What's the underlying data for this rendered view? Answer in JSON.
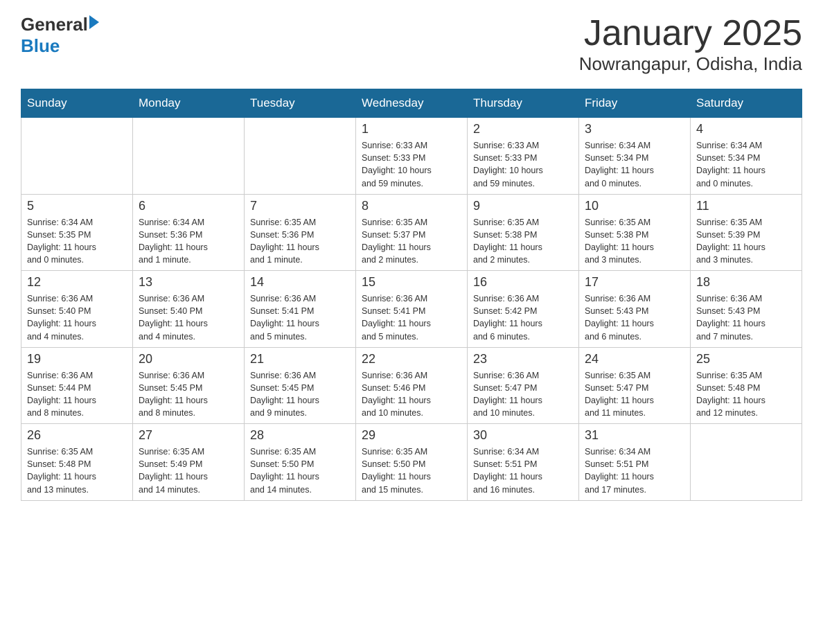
{
  "header": {
    "logo_general": "General",
    "logo_blue": "Blue",
    "month_title": "January 2025",
    "location": "Nowrangapur, Odisha, India"
  },
  "weekdays": [
    "Sunday",
    "Monday",
    "Tuesday",
    "Wednesday",
    "Thursday",
    "Friday",
    "Saturday"
  ],
  "weeks": [
    [
      {
        "day": "",
        "info": ""
      },
      {
        "day": "",
        "info": ""
      },
      {
        "day": "",
        "info": ""
      },
      {
        "day": "1",
        "info": "Sunrise: 6:33 AM\nSunset: 5:33 PM\nDaylight: 10 hours\nand 59 minutes."
      },
      {
        "day": "2",
        "info": "Sunrise: 6:33 AM\nSunset: 5:33 PM\nDaylight: 10 hours\nand 59 minutes."
      },
      {
        "day": "3",
        "info": "Sunrise: 6:34 AM\nSunset: 5:34 PM\nDaylight: 11 hours\nand 0 minutes."
      },
      {
        "day": "4",
        "info": "Sunrise: 6:34 AM\nSunset: 5:34 PM\nDaylight: 11 hours\nand 0 minutes."
      }
    ],
    [
      {
        "day": "5",
        "info": "Sunrise: 6:34 AM\nSunset: 5:35 PM\nDaylight: 11 hours\nand 0 minutes."
      },
      {
        "day": "6",
        "info": "Sunrise: 6:34 AM\nSunset: 5:36 PM\nDaylight: 11 hours\nand 1 minute."
      },
      {
        "day": "7",
        "info": "Sunrise: 6:35 AM\nSunset: 5:36 PM\nDaylight: 11 hours\nand 1 minute."
      },
      {
        "day": "8",
        "info": "Sunrise: 6:35 AM\nSunset: 5:37 PM\nDaylight: 11 hours\nand 2 minutes."
      },
      {
        "day": "9",
        "info": "Sunrise: 6:35 AM\nSunset: 5:38 PM\nDaylight: 11 hours\nand 2 minutes."
      },
      {
        "day": "10",
        "info": "Sunrise: 6:35 AM\nSunset: 5:38 PM\nDaylight: 11 hours\nand 3 minutes."
      },
      {
        "day": "11",
        "info": "Sunrise: 6:35 AM\nSunset: 5:39 PM\nDaylight: 11 hours\nand 3 minutes."
      }
    ],
    [
      {
        "day": "12",
        "info": "Sunrise: 6:36 AM\nSunset: 5:40 PM\nDaylight: 11 hours\nand 4 minutes."
      },
      {
        "day": "13",
        "info": "Sunrise: 6:36 AM\nSunset: 5:40 PM\nDaylight: 11 hours\nand 4 minutes."
      },
      {
        "day": "14",
        "info": "Sunrise: 6:36 AM\nSunset: 5:41 PM\nDaylight: 11 hours\nand 5 minutes."
      },
      {
        "day": "15",
        "info": "Sunrise: 6:36 AM\nSunset: 5:41 PM\nDaylight: 11 hours\nand 5 minutes."
      },
      {
        "day": "16",
        "info": "Sunrise: 6:36 AM\nSunset: 5:42 PM\nDaylight: 11 hours\nand 6 minutes."
      },
      {
        "day": "17",
        "info": "Sunrise: 6:36 AM\nSunset: 5:43 PM\nDaylight: 11 hours\nand 6 minutes."
      },
      {
        "day": "18",
        "info": "Sunrise: 6:36 AM\nSunset: 5:43 PM\nDaylight: 11 hours\nand 7 minutes."
      }
    ],
    [
      {
        "day": "19",
        "info": "Sunrise: 6:36 AM\nSunset: 5:44 PM\nDaylight: 11 hours\nand 8 minutes."
      },
      {
        "day": "20",
        "info": "Sunrise: 6:36 AM\nSunset: 5:45 PM\nDaylight: 11 hours\nand 8 minutes."
      },
      {
        "day": "21",
        "info": "Sunrise: 6:36 AM\nSunset: 5:45 PM\nDaylight: 11 hours\nand 9 minutes."
      },
      {
        "day": "22",
        "info": "Sunrise: 6:36 AM\nSunset: 5:46 PM\nDaylight: 11 hours\nand 10 minutes."
      },
      {
        "day": "23",
        "info": "Sunrise: 6:36 AM\nSunset: 5:47 PM\nDaylight: 11 hours\nand 10 minutes."
      },
      {
        "day": "24",
        "info": "Sunrise: 6:35 AM\nSunset: 5:47 PM\nDaylight: 11 hours\nand 11 minutes."
      },
      {
        "day": "25",
        "info": "Sunrise: 6:35 AM\nSunset: 5:48 PM\nDaylight: 11 hours\nand 12 minutes."
      }
    ],
    [
      {
        "day": "26",
        "info": "Sunrise: 6:35 AM\nSunset: 5:48 PM\nDaylight: 11 hours\nand 13 minutes."
      },
      {
        "day": "27",
        "info": "Sunrise: 6:35 AM\nSunset: 5:49 PM\nDaylight: 11 hours\nand 14 minutes."
      },
      {
        "day": "28",
        "info": "Sunrise: 6:35 AM\nSunset: 5:50 PM\nDaylight: 11 hours\nand 14 minutes."
      },
      {
        "day": "29",
        "info": "Sunrise: 6:35 AM\nSunset: 5:50 PM\nDaylight: 11 hours\nand 15 minutes."
      },
      {
        "day": "30",
        "info": "Sunrise: 6:34 AM\nSunset: 5:51 PM\nDaylight: 11 hours\nand 16 minutes."
      },
      {
        "day": "31",
        "info": "Sunrise: 6:34 AM\nSunset: 5:51 PM\nDaylight: 11 hours\nand 17 minutes."
      },
      {
        "day": "",
        "info": ""
      }
    ]
  ]
}
